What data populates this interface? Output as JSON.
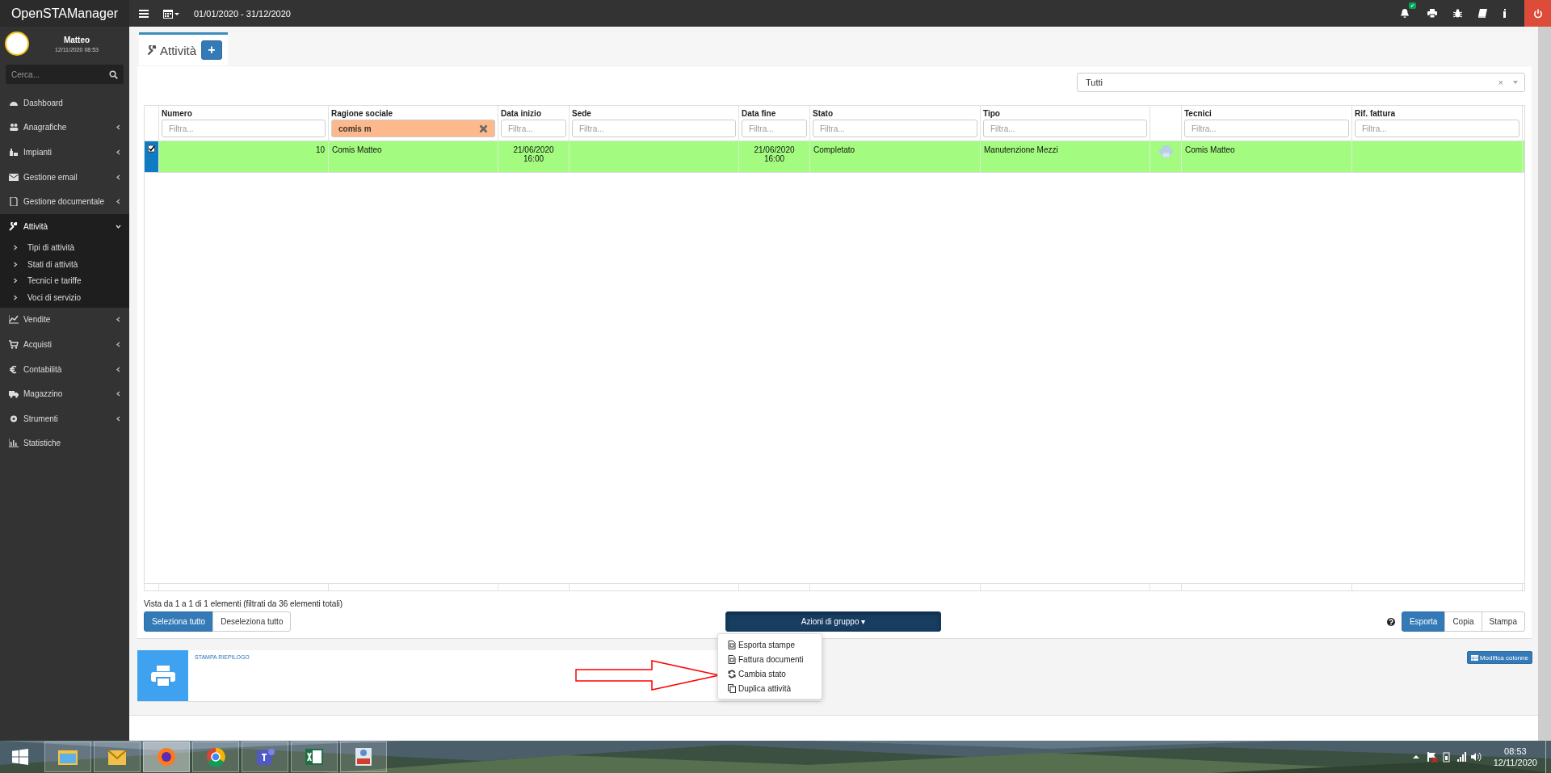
{
  "header": {
    "brand": "OpenSTAManager",
    "date_range": "01/01/2020 - 31/12/2020",
    "notification_badge": "✔"
  },
  "user": {
    "name": "Matteo",
    "datetime": "12/11/2020 08:53"
  },
  "sidebar": {
    "search": {
      "placeholder": "Cerca..."
    },
    "items": [
      {
        "label": "Dashboard",
        "expandable": false,
        "expanded": false,
        "selected": false
      },
      {
        "label": "Anagrafiche",
        "expandable": true,
        "expanded": false,
        "selected": false
      },
      {
        "label": "Impianti",
        "expandable": true,
        "expanded": false,
        "selected": false
      },
      {
        "label": "Gestione email",
        "expandable": true,
        "expanded": false,
        "selected": false
      },
      {
        "label": "Gestione documentale",
        "expandable": true,
        "expanded": false,
        "selected": false
      },
      {
        "label": "Attività",
        "expandable": true,
        "expanded": true,
        "selected": true,
        "children": [
          {
            "label": "Tipi di attività"
          },
          {
            "label": "Stati di attività"
          },
          {
            "label": "Tecnici e tariffe"
          },
          {
            "label": "Voci di servizio"
          }
        ]
      },
      {
        "label": "Vendite",
        "expandable": true,
        "expanded": false,
        "selected": false
      },
      {
        "label": "Acquisti",
        "expandable": true,
        "expanded": false,
        "selected": false
      },
      {
        "label": "Contabilità",
        "expandable": true,
        "expanded": false,
        "selected": false
      },
      {
        "label": "Magazzino",
        "expandable": true,
        "expanded": false,
        "selected": false
      },
      {
        "label": "Strumenti",
        "expandable": true,
        "expanded": false,
        "selected": false
      },
      {
        "label": "Statistiche",
        "expandable": false,
        "expanded": false,
        "selected": false
      }
    ]
  },
  "tab": {
    "label": "Attività",
    "add_button": "+"
  },
  "segment_filter": {
    "value": "Tutti",
    "clear": "×"
  },
  "table": {
    "columns": [
      {
        "kind": "check"
      },
      {
        "kind": "text",
        "label": "Numero",
        "filter": {
          "placeholder": "Filtra..."
        }
      },
      {
        "kind": "text",
        "label": "Ragione sociale",
        "filter": {
          "value": "comis m"
        }
      },
      {
        "kind": "text",
        "label": "Data inizio",
        "filter": {
          "placeholder": "Filtra..."
        }
      },
      {
        "kind": "text",
        "label": "Sede",
        "filter": {
          "placeholder": "Filtra..."
        }
      },
      {
        "kind": "text",
        "label": "Data fine",
        "filter": {
          "placeholder": "Filtra..."
        }
      },
      {
        "kind": "text",
        "label": "Stato",
        "filter": {
          "placeholder": "Filtra..."
        }
      },
      {
        "kind": "text",
        "label": "Tipo",
        "filter": {
          "placeholder": "Filtra..."
        }
      },
      {
        "kind": "icon"
      },
      {
        "kind": "text",
        "label": "Tecnici",
        "filter": {
          "placeholder": "Filtra..."
        }
      },
      {
        "kind": "text",
        "label": "Rif. fattura",
        "filter": {
          "placeholder": "Filtra..."
        }
      }
    ],
    "rows": [
      {
        "selected": true,
        "color": "#a3fc80",
        "cells": [
          {
            "kind": "check"
          },
          {
            "kind": "text",
            "text": "10"
          },
          {
            "kind": "text",
            "text": "Comis Matteo"
          },
          {
            "kind": "text",
            "text": "21/06/2020\n16:00"
          },
          {
            "kind": "empty"
          },
          {
            "kind": "text",
            "text": "21/06/2020\n16:00"
          },
          {
            "kind": "text",
            "text": "Completato"
          },
          {
            "kind": "text",
            "text": "Manutenzione Mezzi"
          },
          {
            "kind": "print_icon"
          },
          {
            "kind": "text",
            "text": "Comis Matteo"
          },
          {
            "kind": "empty"
          }
        ]
      }
    ]
  },
  "table_info": "Vista da 1 a 1 di 1 elementi (filtrati da 36 elementi totali)",
  "selection_buttons": [
    {
      "label": "Seleziona tutto",
      "primary": true
    },
    {
      "label": "Deseleziona tutto",
      "primary": false
    }
  ],
  "group_actions": {
    "label": "Azioni di gruppo",
    "caret": "▾",
    "expanded": true,
    "items": [
      {
        "label": "Esporta stampe"
      },
      {
        "label": "Fattura documenti"
      },
      {
        "label": "Cambia stato"
      },
      {
        "label": "Duplica attività"
      }
    ]
  },
  "export_buttons": [
    {
      "label": "Esporta",
      "selected": true
    },
    {
      "label": "Copia",
      "selected": false
    },
    {
      "label": "Stampa",
      "selected": false
    }
  ],
  "widget": {
    "title": "STAMPA RIEPILOGO"
  },
  "modify_columns": "Modifica colonne",
  "taskbar": {
    "apps": [
      {
        "active": false
      },
      {
        "active": false
      },
      {
        "active": true
      },
      {
        "active": false
      },
      {
        "active": false
      },
      {
        "active": false
      },
      {
        "active": false
      }
    ],
    "time": "08:53",
    "date": "12/11/2020"
  }
}
